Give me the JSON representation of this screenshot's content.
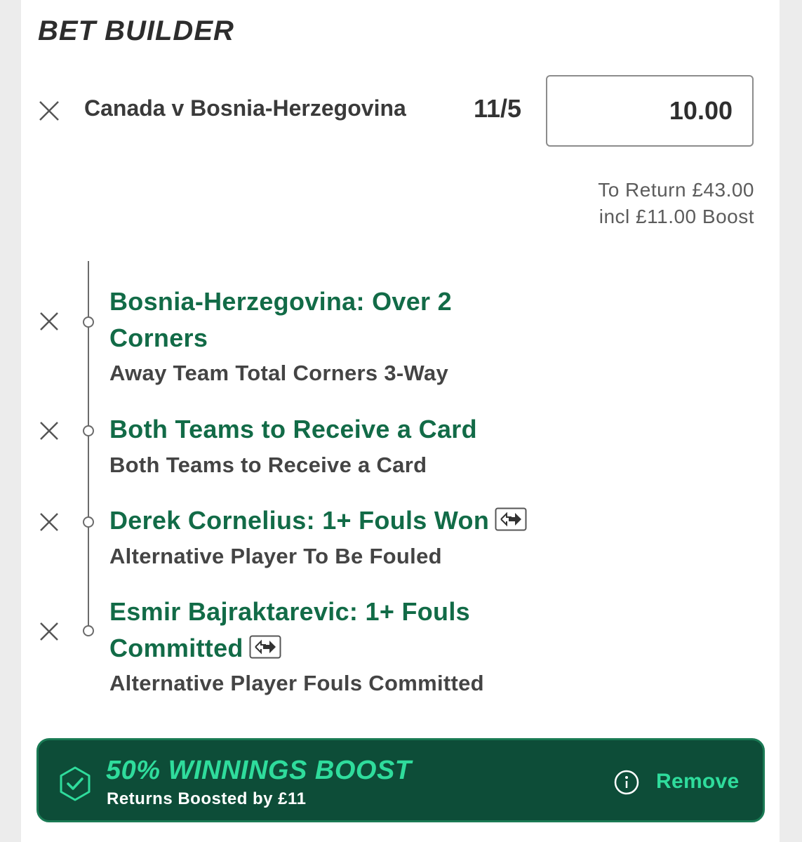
{
  "header": {
    "title": "BET BUILDER"
  },
  "bet": {
    "event": "Canada v Bosnia-Herzegovina",
    "odds": "11/5",
    "stake_value": "10.00",
    "to_return": "To Return £43.00",
    "boost_note": "incl £11.00 Boost"
  },
  "selections": [
    {
      "title_line1": "Bosnia-Herzegovina: Over 2",
      "title_line2": "Corners",
      "market": "Away Team Total Corners 3-Way",
      "swap_icon": false
    },
    {
      "title_line1": "Both Teams to Receive a Card",
      "market": "Both Teams to Receive a Card",
      "swap_icon": false
    },
    {
      "title_line1": "Derek Cornelius: 1+ Fouls Won",
      "market": "Alternative Player To Be Fouled",
      "swap_icon": true
    },
    {
      "title_line1": "Esmir Bajraktarevic: 1+ Fouls",
      "title_line2": "Committed",
      "market": "Alternative Player Fouls Committed",
      "swap_icon": true
    }
  ],
  "boost": {
    "title": "50% WINNINGS BOOST",
    "subtitle": "Returns Boosted by £11",
    "remove_label": "Remove",
    "icons": [
      "shield-check-icon",
      "info-icon"
    ]
  },
  "colors": {
    "selection_green": "#126b47",
    "banner_bg": "#0d4d38",
    "banner_accent": "#2fdc9c"
  }
}
